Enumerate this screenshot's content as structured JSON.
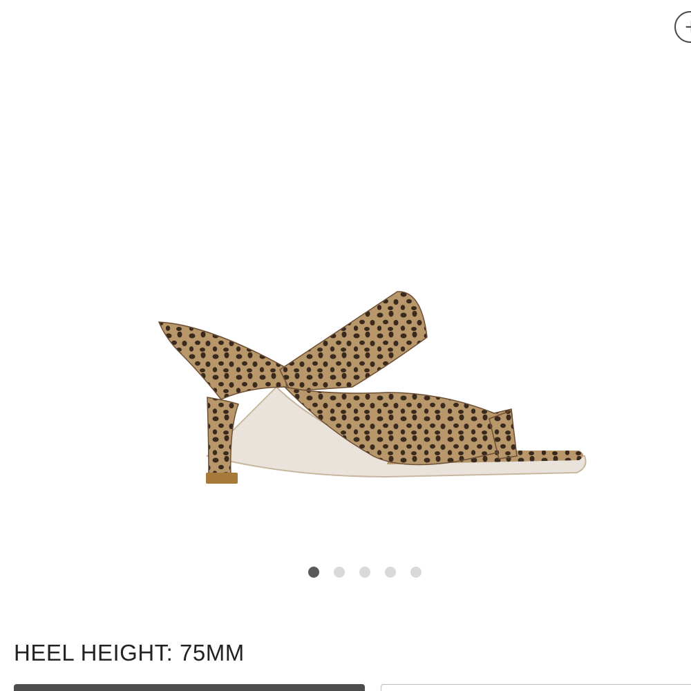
{
  "product": {
    "image_alt": "Leopard print thong sandal with heel",
    "spec_label": "HEEL HEIGHT: 75MM"
  },
  "carousel": {
    "count": 5,
    "active_index": 0
  },
  "zoom": {
    "icon": "plus-icon"
  },
  "colors": {
    "leopard_base": "#b8976b",
    "leopard_spot": "#3a2a1e",
    "heel_tip": "#a87a3a",
    "dot_active": "#5a5a5a",
    "dot_inactive": "#d9d9d9"
  }
}
